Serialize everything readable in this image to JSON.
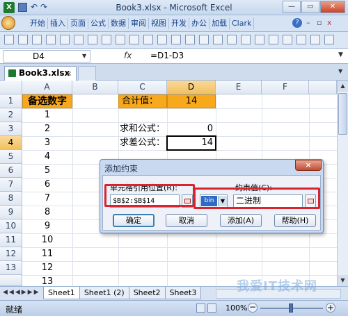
{
  "window": {
    "title": "Book3.xlsx - Microsoft Excel",
    "app_icon": "X"
  },
  "ribbon": {
    "tabs": [
      "开始",
      "插入",
      "页面",
      "公式",
      "数据",
      "审阅",
      "视图",
      "开发",
      "办公",
      "加载",
      "Clark"
    ]
  },
  "formula_bar": {
    "cell_ref": "D4",
    "fx": "fx",
    "formula": "=D1-D3"
  },
  "workbook_tab": {
    "name": "Book3.xlsx",
    "close": "×"
  },
  "grid": {
    "columns": [
      "A",
      "B",
      "C",
      "D",
      "E",
      "F"
    ],
    "rows": [
      "1",
      "2",
      "3",
      "4",
      "5",
      "6",
      "7",
      "8",
      "9",
      "10",
      "11",
      "12",
      "13"
    ],
    "selected_col": "D",
    "selected_row": "4",
    "a_values": [
      "备选数字",
      "1",
      "2",
      "3",
      "4",
      "5",
      "6",
      "7",
      "8",
      "9",
      "10",
      "11",
      "12",
      "13"
    ],
    "c1": "合计值：",
    "d1": "14",
    "c3": "求和公式：",
    "d3": "0",
    "c4": "求差公式：",
    "d4": "14"
  },
  "sheets": {
    "tabs": [
      "Sheet1",
      "Sheet1 (2)",
      "Sheet2",
      "Sheet3"
    ],
    "active": "Sheet1"
  },
  "status": {
    "ready": "就绪",
    "zoom": "100%",
    "zoom_minus": "−",
    "zoom_plus": "+"
  },
  "dialog": {
    "title": "添加约束",
    "close": "×",
    "cell_ref_label": "单元格引用位置(R):",
    "cell_ref_value": "$B$2:$B$14",
    "operator_value": "bin",
    "constraint_label": "约束值(C):",
    "constraint_value": "二进制",
    "buttons": {
      "ok": "确定",
      "cancel": "取消",
      "add": "添加(A)",
      "help": "帮助(H)"
    }
  },
  "watermark": "我爱IT技术网"
}
